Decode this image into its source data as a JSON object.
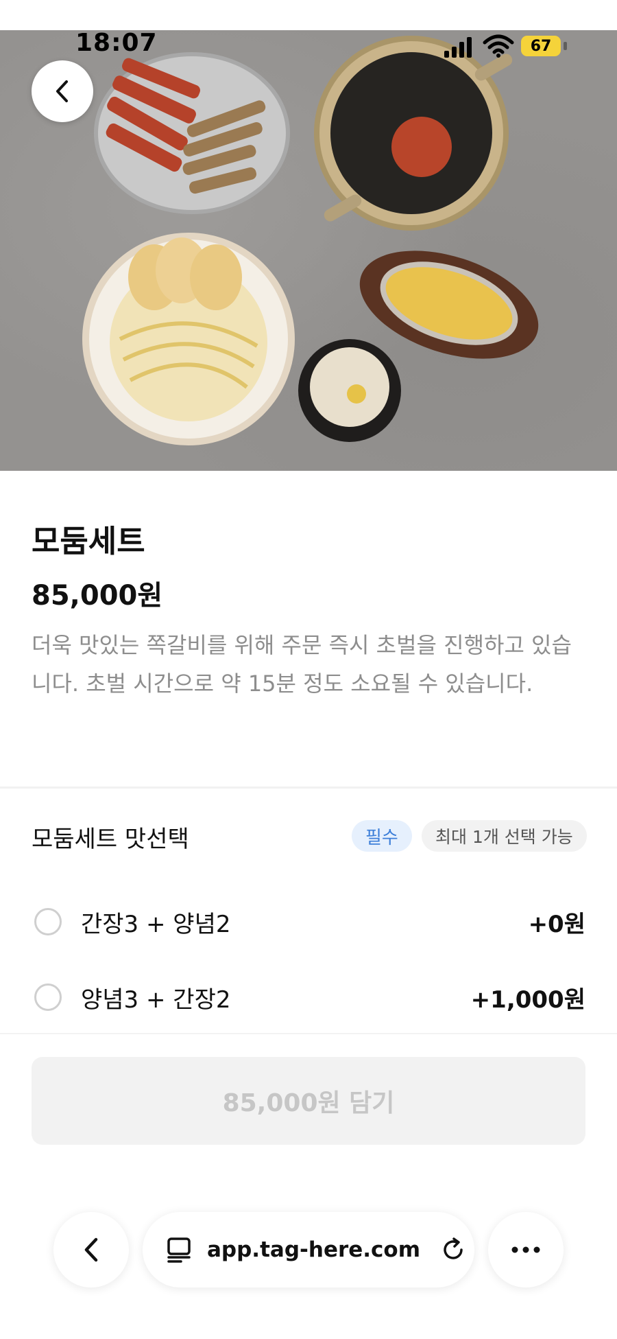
{
  "status_bar": {
    "time": "18:07",
    "battery": "67"
  },
  "product": {
    "name": "모둠세트",
    "price": "85,000원",
    "description": "더욱 맛있는 쪽갈비를 위해 주문 즉시 초벌을 진행하고 있습니다. 초벌 시간으로 약 15분 정도 소요될 수 있습니다."
  },
  "option_group": {
    "title": "모둠세트 맛선택",
    "required_badge": "필수",
    "max_badge": "최대 1개 선택 가능",
    "options": [
      {
        "label": "간장3 + 양념2",
        "price": "+0원"
      },
      {
        "label": "양념3 + 간장2",
        "price": "+1,000원"
      }
    ]
  },
  "cart_button": {
    "label": "85,000원 담기"
  },
  "browser": {
    "url": "app.tag-here.com"
  },
  "colors": {
    "required_badge_text": "#3d7fd9",
    "required_badge_bg": "#e6f0fd",
    "battery": "#f5d33a"
  },
  "icons": [
    "back-arrow-icon",
    "signal-icon",
    "wifi-icon",
    "battery-icon",
    "reader-mode-icon",
    "reload-icon",
    "more-icon"
  ]
}
